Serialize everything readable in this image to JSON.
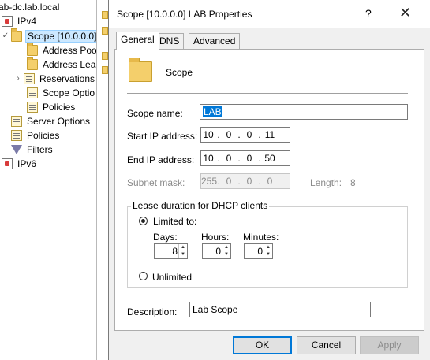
{
  "tree": {
    "root": "ab-dc.lab.local",
    "ipv4": "IPv4",
    "scope": "Scope [10.0.0.0]",
    "address_pool": "Address Poo",
    "address_leases": "Address Leas",
    "reservations": "Reservations",
    "scope_options": "Scope Optio",
    "policies_child": "Policies",
    "server_options": "Server Options",
    "policies": "Policies",
    "filters": "Filters",
    "ipv6": "IPv6"
  },
  "dialog": {
    "title": "Scope [10.0.0.0] LAB Properties",
    "help": "?",
    "close": "✕",
    "tabs": [
      "General",
      "DNS",
      "Advanced"
    ],
    "header_label": "Scope",
    "scope_name_label": "Scope name:",
    "scope_name_value": "LAB",
    "start_ip_label": "Start IP address:",
    "start_ip": [
      "10",
      "0",
      "0",
      "11"
    ],
    "end_ip_label": "End IP address:",
    "end_ip": [
      "10",
      "0",
      "0",
      "50"
    ],
    "subnet_label": "Subnet mask:",
    "subnet": [
      "255",
      "0",
      "0",
      "0"
    ],
    "length_label": "Length:",
    "length_value": "8",
    "lease_group_title": "Lease duration for DHCP clients",
    "limited_label": "Limited to:",
    "days_label": "Days:",
    "hours_label": "Hours:",
    "minutes_label": "Minutes:",
    "days_value": "8",
    "hours_value": "0",
    "minutes_value": "0",
    "unlimited_label": "Unlimited",
    "description_label": "Description:",
    "description_value": "Lab Scope",
    "ok": "OK",
    "cancel": "Cancel",
    "apply": "Apply"
  }
}
